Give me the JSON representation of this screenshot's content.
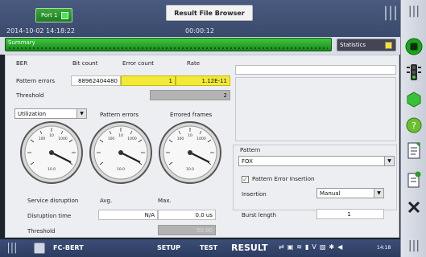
{
  "header": {
    "port_tab": "Port 1",
    "file_button": "Result File Browser",
    "datetime": "2014-10-02 14:18:22",
    "elapsed": "00:00:12"
  },
  "summary": {
    "label": "Summary",
    "statistics_label": "Statistics"
  },
  "ber": {
    "title": "BER",
    "col_bit_count": "Bit count",
    "col_error_count": "Error count",
    "col_rate": "Rate",
    "row_pattern_errors": "Pattern errors",
    "bit_count": "88962404480",
    "error_count": "1",
    "rate": "1.12E-11",
    "threshold_label": "Threshold",
    "threshold_value": "2"
  },
  "gauges": {
    "mode_select": "Utilization",
    "pattern_errors_title": "Pattern errors",
    "errored_frames_title": "Errored frames",
    "ticks": [
      "10",
      "100",
      "1000",
      "10.0"
    ],
    "values": {
      "utilization": 0.0,
      "pattern_errors": 0.0,
      "errored_frames": 0.0
    }
  },
  "disruption": {
    "service_disruption": "Service disruption",
    "avg_label": "Avg.",
    "max_label": "Max.",
    "disruption_time_label": "Disruption time",
    "avg_value": "N/A",
    "max_value": "0.0 us",
    "threshold_label": "Threshold",
    "threshold_value": "50.00"
  },
  "pattern": {
    "group_label": "Pattern",
    "value": "FOX",
    "insertion_group": "Pattern Error Insertion",
    "insertion_label": "Insertion",
    "insertion_value": "Manual",
    "burst_label": "Burst length",
    "burst_value": "1"
  },
  "bottom": {
    "app_name": "FC-BERT",
    "setup": "SETUP",
    "test": "TEST",
    "result": "RESULT",
    "clock": "14:18"
  },
  "colors": {
    "accent_green": "#21a221",
    "yellow": "#f2ea3a",
    "header_blue": "#3e4f73"
  }
}
